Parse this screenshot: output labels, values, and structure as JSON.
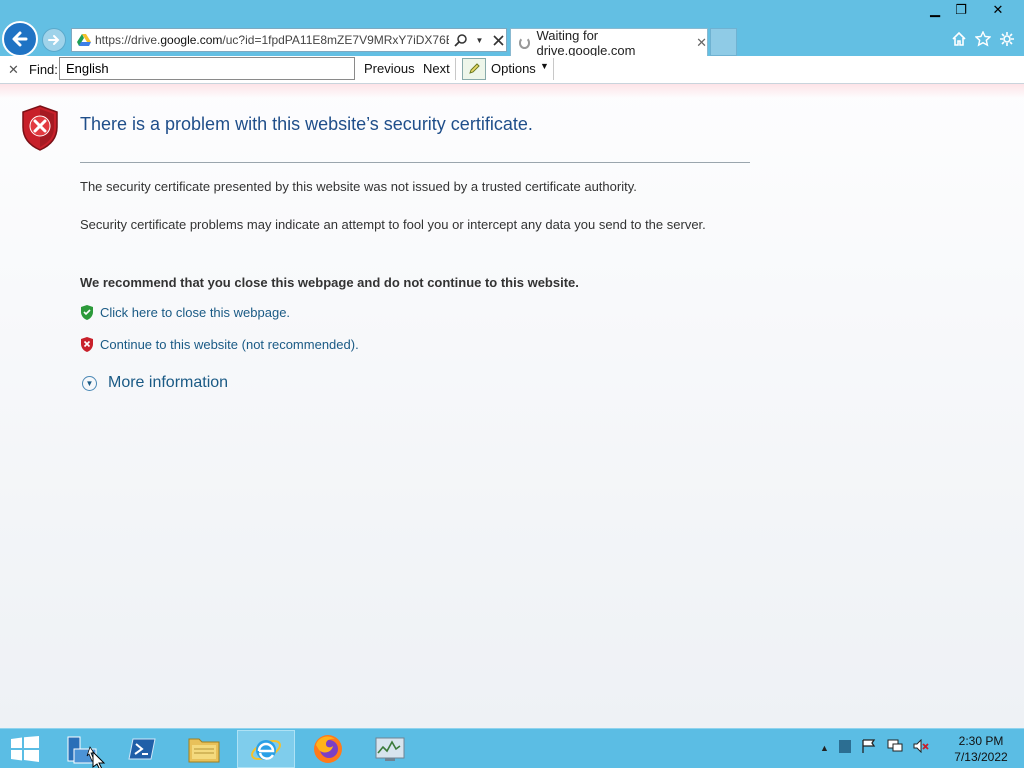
{
  "window": {
    "minimize_symbol": "▁",
    "maximize_symbol": "❐",
    "close_symbol": "✕"
  },
  "address_bar": {
    "url_prefix": "https://drive.",
    "url_domain": "google.com",
    "url_rest": "/uc?id=1fpdPA11E8mZE7V9MRxY7iDX76B("
  },
  "tab": {
    "title": "Waiting for drive.google.com",
    "close_symbol": "✕"
  },
  "findbar": {
    "close_symbol": "✕",
    "label": "Find:",
    "query": "English",
    "previous_label": "Previous",
    "next_label": "Next",
    "options_label": "Options"
  },
  "page": {
    "heading": "There is a problem with this website’s security certificate.",
    "para1": "The security certificate presented by this website was not issued by a trusted certificate authority.",
    "para2": "Security certificate problems may indicate an attempt to fool you or intercept any data you send to the server.",
    "recommendation": "We recommend that you close this webpage and do not continue to this website.",
    "close_link": "Click here to close this webpage.",
    "continue_link": "Continue to this website (not recommended).",
    "more_info": "More information"
  },
  "taskbar": {
    "items": [
      "server-manager",
      "powershell",
      "file-explorer",
      "internet-explorer",
      "firefox",
      "task-manager"
    ],
    "active_item": "internet-explorer",
    "time": "2:30 PM",
    "date": "7/13/2022"
  },
  "colors": {
    "chrome": "#63bfe3",
    "link": "#1a5a85",
    "heading": "#1f4e8a",
    "shield_red": "#c8202a",
    "shield_green": "#2c9a3a"
  }
}
